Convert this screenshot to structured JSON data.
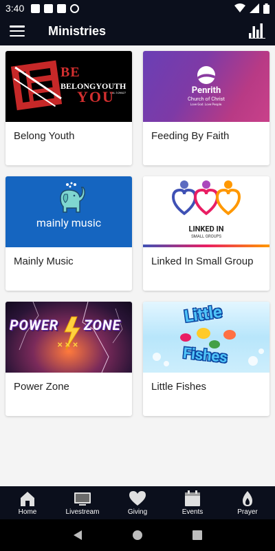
{
  "status_bar": {
    "time": "3:40"
  },
  "app_bar": {
    "title": "Ministries"
  },
  "ministries": [
    {
      "title": "Belong Youth",
      "image_text": {
        "line1": "BE",
        "line2": "BELONGYOUTH",
        "line3": "YOU",
        "ref": "GAL 3:26&27"
      }
    },
    {
      "title": "Feeding By Faith",
      "image_text": {
        "line1": "Penrith",
        "line2": "Church of Christ",
        "line3": "Love God. Love People."
      }
    },
    {
      "title": "Mainly Music",
      "image_text": {
        "line1": "mainly music"
      }
    },
    {
      "title": "Linked In Small Group",
      "image_text": {
        "line1": "LINKED IN",
        "line2": "SMALL GROUPS"
      }
    },
    {
      "title": "Power Zone",
      "image_text": {
        "line1": "POWER",
        "line2": "ZONE"
      }
    },
    {
      "title": "Little Fishes",
      "image_text": {
        "line1": "Little",
        "line2": "Fishes"
      }
    }
  ],
  "bottom_nav": [
    {
      "label": "Home",
      "icon": "home-icon"
    },
    {
      "label": "Livestream",
      "icon": "tv-icon"
    },
    {
      "label": "Giving",
      "icon": "heart-icon"
    },
    {
      "label": "Events",
      "icon": "calendar-icon"
    },
    {
      "label": "Prayer",
      "icon": "flame-icon"
    }
  ],
  "colors": {
    "bar_bg": "#0b0f1c",
    "accent_red": "#d32f2f",
    "mainly_blue": "#1565c0"
  }
}
